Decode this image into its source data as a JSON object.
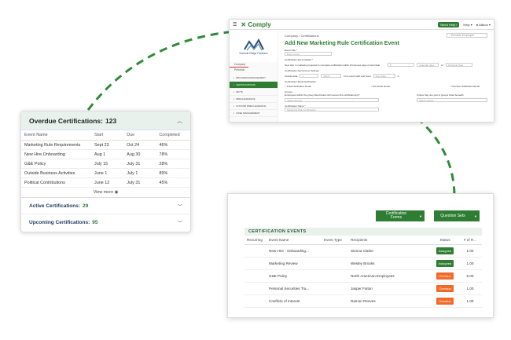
{
  "colors": {
    "accent": "#2e7d32",
    "assigned": "#2e7d32",
    "overdue": "#f26a2a",
    "dash": "#2e8b3a"
  },
  "top_window": {
    "logo": "Comply",
    "need_help": "Need Help?",
    "help_menu": "Help",
    "user": "Allison",
    "org_name": "Summit Ridge Partners",
    "sidebar_tabs": [
      "Company",
      "Personal"
    ],
    "sidebar_items": [
      {
        "label": "PROGRAM MANAGEMENT",
        "active": false
      },
      {
        "label": "CERTIFICATIONS",
        "active": true
      },
      {
        "label": "GIFTS",
        "active": false
      },
      {
        "label": "PRECLEARANCE",
        "active": false
      },
      {
        "label": "CUSTOM PRECLEARANCE",
        "active": false
      },
      {
        "label": "CASE MANAGEMENT",
        "active": false
      }
    ],
    "breadcrumb": "Company  /  Certifications",
    "search_placeholder": "Emulate Employee",
    "page_title": "Add New Marketing Rule Certification Event",
    "event_title_label": "Event Title *",
    "event_title_placeholder": "Event name",
    "due_date_label": "Certification Event details *",
    "due_text": "New Hire in marketing required to complete certification within # business days of start date",
    "due_value": "5",
    "calendar_days": "Calendar days",
    "of": "of",
    "schedule_date": "Schedule Date",
    "recurrence_label": "Certification Recurrence Settings",
    "recur_row": [
      "Include data",
      "1",
      "Month",
      "from event start and reset",
      "Start Date"
    ],
    "email_label": "Certification Email Notification",
    "email_options": [
      "Initial Notification Email",
      "Reminder Email",
      "Overdue Notification Email"
    ],
    "groups_label": "Groups",
    "groups_text": "Employees within the group listed below will receive this certification(s)?",
    "groups_placeholder": "Select Groups",
    "unless_text": "Unless they are part of groups listed beneath",
    "select_groups": "Select groups",
    "cert_name_label": "Certification Name *",
    "cert_name_placeholder": "Marketing Rule Certification"
  },
  "overdue": {
    "title": "Overdue Certifications:",
    "count": "123",
    "columns": [
      "Event Name",
      "Start",
      "Due",
      "Completed"
    ],
    "rows": [
      [
        "Marketing Rule Requirements",
        "Sept 23",
        "Oct 24",
        "46%"
      ],
      [
        "New Hire Onboarding",
        "Aug 1",
        "Aug 30",
        "78%"
      ],
      [
        "G&E Policy",
        "July 15",
        "July 31",
        "28%"
      ],
      [
        "Outside Business Activities",
        "June 1",
        "July 1",
        "89%"
      ],
      [
        "Political Contributions",
        "June 12",
        "July 31",
        "45%"
      ]
    ],
    "view_more": "View more"
  },
  "active": {
    "title": "Active Certifications:",
    "count": "29"
  },
  "upcoming": {
    "title": "Upcoming Certifications:",
    "count": "95"
  },
  "events": {
    "btn_forms": "Certification Forms",
    "btn_questions": "Question Sets",
    "header": "CERTIFICATION EVENTS",
    "columns": [
      "Recurring",
      "Event Name",
      "Event Type",
      "Recipients",
      "Status",
      "# of R..."
    ],
    "rows": [
      {
        "name": "New Hire - Onboarding...",
        "recipients": "Sienna Clarke",
        "status": "Assigned",
        "count": "1.00"
      },
      {
        "name": "Marketing Review",
        "recipients": "Wesley Brooks",
        "status": "Assigned",
        "count": "1.00"
      },
      {
        "name": "G&E Policy",
        "recipients": "North American Employees",
        "status": "Overdue",
        "count": "5.00"
      },
      {
        "name": "Personal Securities Tra...",
        "recipients": "Jasper Fulton",
        "status": "Overdue",
        "count": "1.00"
      },
      {
        "name": "Conflicts of Interest",
        "recipients": "Damon Reeves",
        "status": "Overdue",
        "count": "1.00"
      }
    ]
  }
}
